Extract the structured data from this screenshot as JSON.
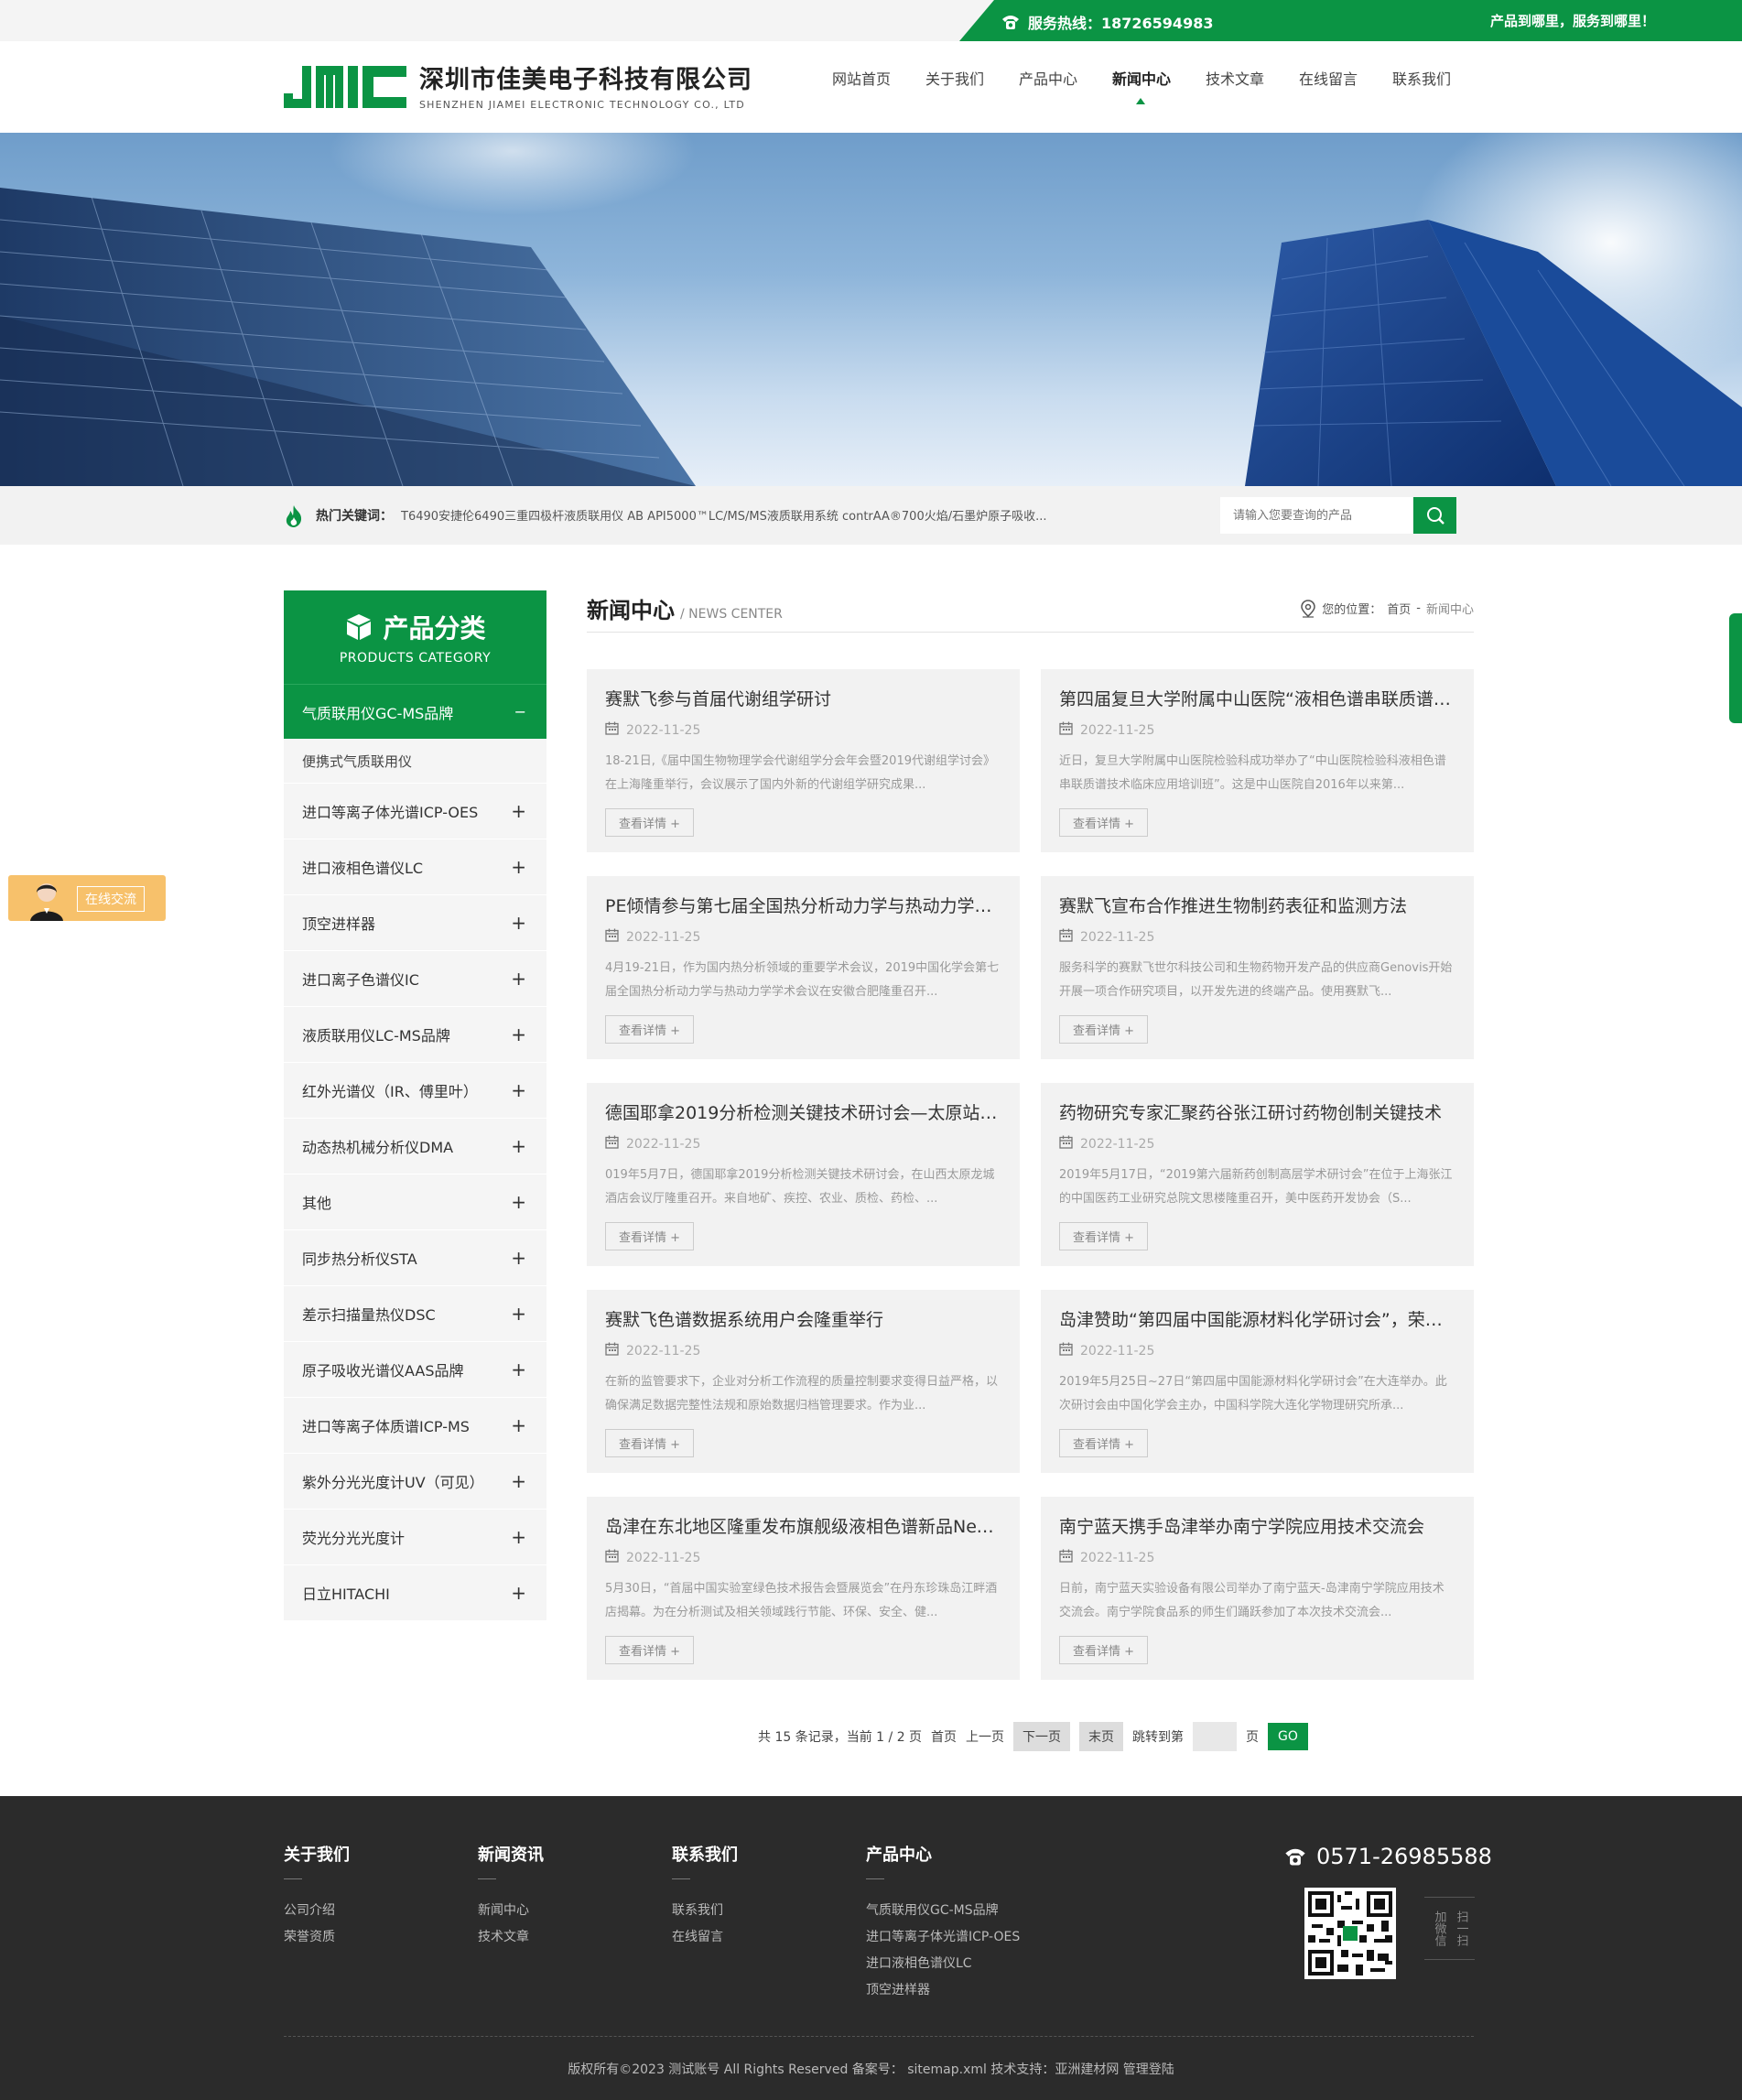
{
  "topbar": {
    "hotline": "服务热线：18726594983",
    "slogan": "产品到哪里，服务到哪里！"
  },
  "brand": {
    "logo_text": "JMIC",
    "company_cn": "深圳市佳美电子科技有限公司",
    "company_en": "SHENZHEN JIAMEI ELECTRONIC TECHNOLOGY CO., LTD"
  },
  "nav": {
    "items": [
      "网站首页",
      "关于我们",
      "产品中心",
      "新闻中心",
      "技术文章",
      "在线留言",
      "联系我们"
    ],
    "active": "新闻中心"
  },
  "search": {
    "hot_label": "热门关键词：",
    "hot_words": "T6490安捷伦6490三重四极杆液质联用仪 AB API5000™LC/MS/MS液质联用系统 contrAA®700火焰/石墨炉原子吸收...",
    "placeholder": "请输入您要查询的产品"
  },
  "sidebar": {
    "title": "产品分类",
    "subtitle": "PRODUCTS CATEGORY",
    "active_item": "气质联用仪GC-MS品牌",
    "active_symbol": "−",
    "sub_items": [
      "便携式气质联用仪"
    ],
    "items": [
      "进口等离子体光谱ICP-OES",
      "进口液相色谱仪LC",
      "顶空进样器",
      "进口离子色谱仪IC",
      "液质联用仪LC-MS品牌",
      "红外光谱仪（IR、傅里叶）",
      "动态热机械分析仪DMA",
      "其他",
      "同步热分析仪STA",
      "差示扫描量热仪DSC",
      "原子吸收光谱仪AAS品牌",
      "进口等离子体质谱ICP-MS",
      "紫外分光光度计UV（可见）",
      "荧光分光光度计",
      "日立HITACHI"
    ],
    "plus_symbol": "+"
  },
  "main": {
    "title": "新闻中心",
    "subtitle": "/ NEWS CENTER",
    "breadcrumb_label": "您的位置：",
    "breadcrumb_home": "首页",
    "breadcrumb_sep": "-",
    "breadcrumb_current": "新闻中心",
    "detail_label": "查看详情 +",
    "news": [
      {
        "title": "赛默飞参与首届代谢组学研讨",
        "date": "2022-11-25",
        "desc": "18-21日,《届中国生物物理学会代谢组学分会年会暨2019代谢组学讨会》在上海隆重举行，会议展示了国内外新的代谢组学研究成果..."
      },
      {
        "title": "第四届复旦大学附属中山医院“液相色谱串联质谱技术...",
        "date": "2022-11-25",
        "desc": "近日，复旦大学附属中山医院检验科成功举办了“中山医院检验科液相色谱串联质谱技术临床应用培训班”。这是中山医院自2016年以来第..."
      },
      {
        "title": "PE倾情参与第七届全国热分析动力学与热动力学学...",
        "date": "2022-11-25",
        "desc": "4月19-21日，作为国内热分析领域的重要学术会议，2019中国化学会第七届全国热分析动力学与热动力学学术会议在安徽合肥隆重召开..."
      },
      {
        "title": "赛默飞宣布合作推进生物制药表征和监测方法",
        "date": "2022-11-25",
        "desc": "服务科学的赛默飞世尔科技公司和生物药物开发产品的供应商Genovis开始开展一项合作研究项目，以开发先进的终端产品。使用赛默飞..."
      },
      {
        "title": "德国耶拿2019分析检测关键技术研讨会—太原站成...",
        "date": "2022-11-25",
        "desc": "019年5月7日，德国耶拿2019分析检测关键技术研讨会，在山西太原龙城酒店会议厅隆重召开。来自地矿、疾控、农业、质检、药检、..."
      },
      {
        "title": "药物研究专家汇聚药谷张江研讨药物创制关键技术",
        "date": "2022-11-25",
        "desc": "2019年5月17日，“2019第六届新药创制高层学术研讨会”在位于上海张江的中国医药工业研究总院文思楼隆重召开，美中医药开发协会（S..."
      },
      {
        "title": "赛默飞色谱数据系统用户会隆重举行",
        "date": "2022-11-25",
        "desc": "在新的监管要求下，企业对分析工作流程的质量控制要求变得日益严格，以确保满足数据完整性法规和原始数据归档管理要求。作为业..."
      },
      {
        "title": "岛津赞助“第四届中国能源材料化学研讨会”，荣获科...",
        "date": "2022-11-25",
        "desc": "2019年5月25日~27日“第四届中国能源材料化学研讨会”在大连举办。此次研讨会由中国化学会主办，中国科学院大连化学物理研究所承..."
      },
      {
        "title": "岛津在东北地区隆重发布旗舰级液相色谱新品Nexer...",
        "date": "2022-11-25",
        "desc": "5月30日，“首届中国实验室绿色技术报告会暨展览会”在丹东珍珠岛江畔酒店揭幕。为在分析测试及相关领域践行节能、环保、安全、健..."
      },
      {
        "title": "南宁蓝天携手岛津举办南宁学院应用技术交流会",
        "date": "2022-11-25",
        "desc": "日前，南宁蓝天实验设备有限公司举办了南宁蓝天-岛津南宁学院应用技术交流会。南宁学院食品系的师生们踊跃参加了本次技术交流会..."
      }
    ]
  },
  "pager": {
    "summary": "共 15 条记录，当前 1 / 2 页",
    "first": "首页",
    "prev": "上一页",
    "next": "下一页",
    "last": "末页",
    "jump_label": "跳转到第",
    "page_unit": "页",
    "go": "GO"
  },
  "float_chat": {
    "label": "在线交流"
  },
  "footer": {
    "cols": [
      {
        "title": "关于我们",
        "links": [
          "公司介绍",
          "荣誉资质"
        ]
      },
      {
        "title": "新闻资讯",
        "links": [
          "新闻中心",
          "技术文章"
        ]
      },
      {
        "title": "联系我们",
        "links": [
          "联系我们",
          "在线留言"
        ]
      },
      {
        "title": "产品中心",
        "links": [
          "气质联用仪GC-MS品牌",
          "进口等离子体光谱ICP-OES",
          "进口液相色谱仪LC",
          "顶空进样器"
        ]
      }
    ],
    "phone": "0571-26985588",
    "qr_side_a": "扫一扫",
    "qr_side_b": "加微信",
    "copyright": "版权所有©2023 测试账号 All Rights Reserved   备案号：   sitemap.xml   技术支持：亚洲建材网   管理登陆"
  },
  "colors": {
    "brand_green": "#0b9444",
    "footer_bg": "#2b2b2b"
  }
}
